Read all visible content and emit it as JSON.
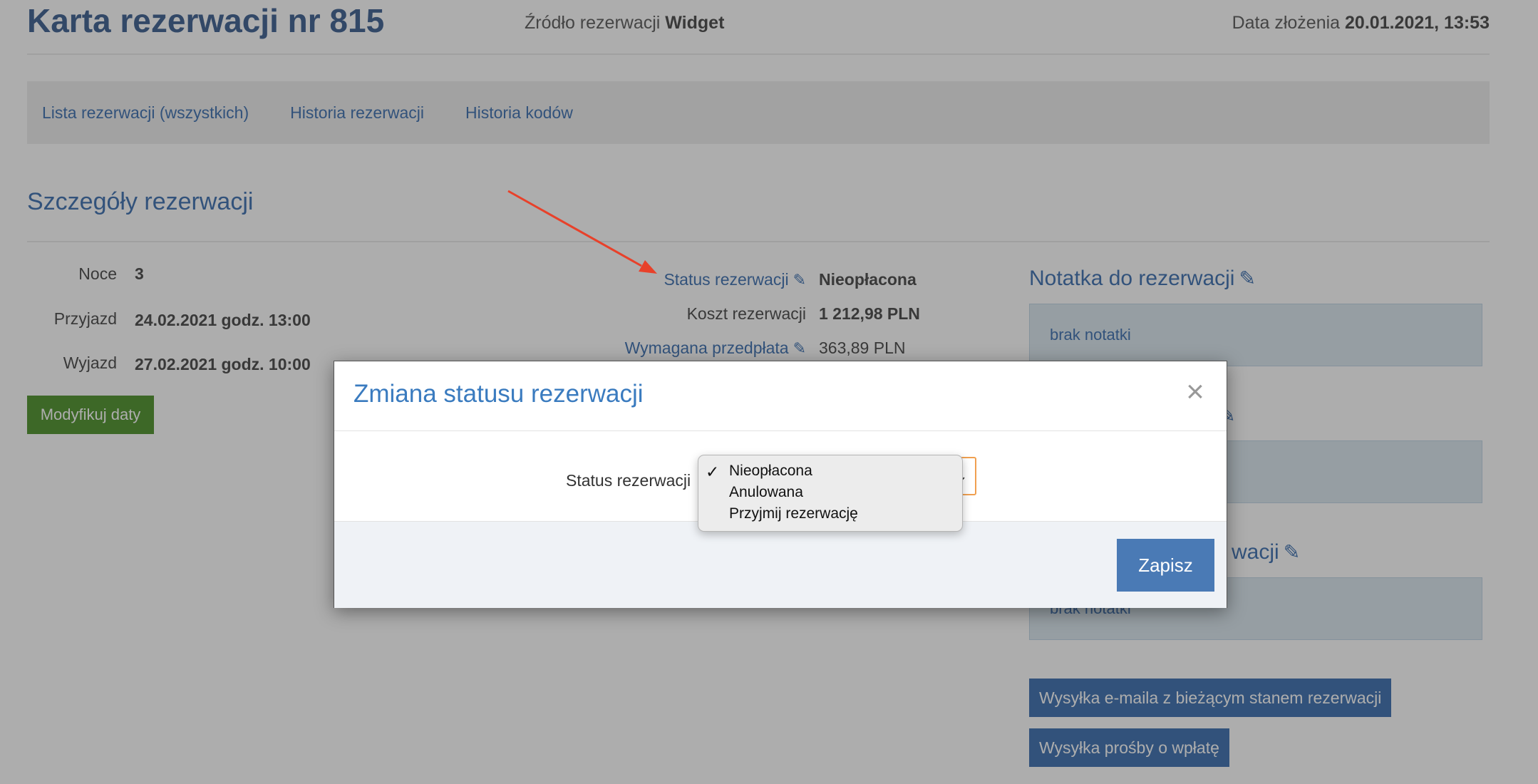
{
  "header": {
    "title": "Karta rezerwacji nr 815",
    "source_label": "Źródło rezerwacji",
    "source_value": "Widget",
    "date_label": "Data złożenia",
    "date_value": "20.01.2021, 13:53"
  },
  "nav": {
    "items": [
      "Lista rezerwacji (wszystkich)",
      "Historia rezerwacji",
      "Historia kodów"
    ]
  },
  "details": {
    "title": "Szczegóły rezerwacji",
    "nights_label": "Noce",
    "nights_value": "3",
    "arrival_label": "Przyjazd",
    "arrival_value": "24.02.2021 godz. 13:00",
    "departure_label": "Wyjazd",
    "departure_value": "27.02.2021 godz. 10:00",
    "modify_button": "Modyfikuj daty",
    "status_label": "Status rezerwacji",
    "status_value": "Nieopłacona",
    "cost_label": "Koszt rezerwacji",
    "cost_value": "1 212,98 PLN",
    "prepayment_label": "Wymagana przedpłata",
    "prepayment_value": "363,89 PLN"
  },
  "notes": {
    "title": "Notatka do rezerwacji",
    "box1": "brak notatki",
    "box3_title_partial": "wacji",
    "box3": "brak notatki"
  },
  "actions": {
    "email_button": "Wysyłka e-maila z bieżącym stanem rezerwacji",
    "payment_request_button": "Wysyłka prośby o wpłatę"
  },
  "modal": {
    "title": "Zmiana statusu rezerwacji",
    "close_symbol": "×",
    "field_label": "Status rezerwacji",
    "save_button": "Zapisz",
    "options": [
      "Nieopłacona",
      "Anulowana",
      "Przyjmij rezerwację"
    ],
    "selected_option": "Nieopłacona",
    "check_symbol": "✓"
  },
  "colors": {
    "link": "#4a7ab5",
    "annotation_arrow": "#e8412a",
    "select_focus": "#f0a050",
    "modify_button": "#5a9a3a"
  }
}
